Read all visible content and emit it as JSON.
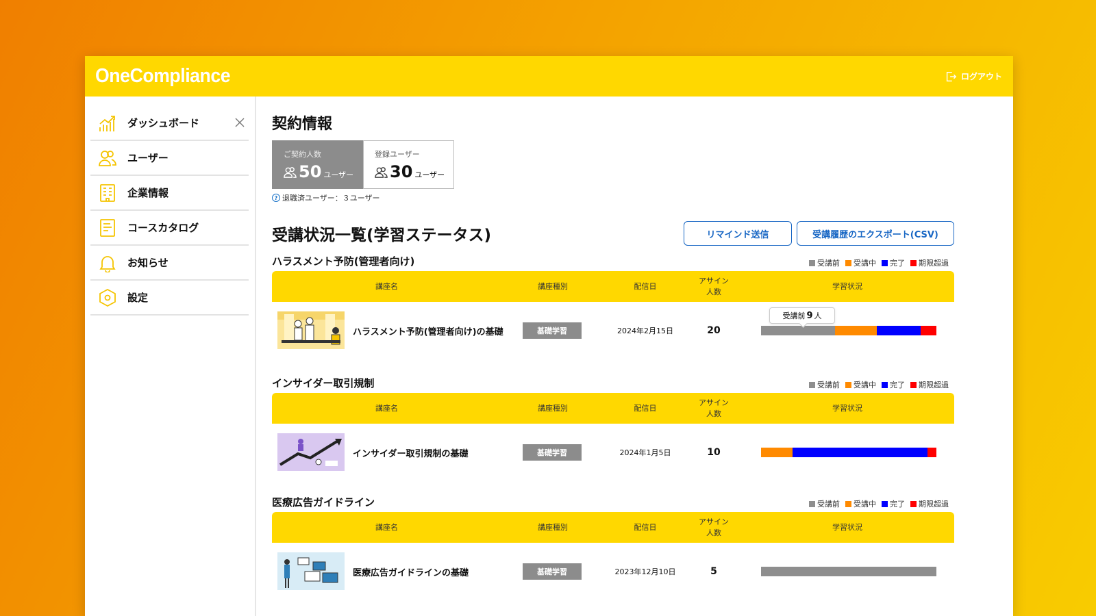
{
  "app": {
    "logo": "OneCompliance",
    "logout_label": "ログアウト"
  },
  "sidebar": {
    "items": [
      {
        "label": "ダッシュボード",
        "icon": "chart-icon"
      },
      {
        "label": "ユーザー",
        "icon": "users-icon"
      },
      {
        "label": "企業情報",
        "icon": "building-icon"
      },
      {
        "label": "コースカタログ",
        "icon": "document-icon"
      },
      {
        "label": "お知らせ",
        "icon": "bell-icon"
      },
      {
        "label": "設定",
        "icon": "settings-icon"
      }
    ]
  },
  "contract": {
    "title": "契約情報",
    "contracted": {
      "label": "ご契約人数",
      "value": "50",
      "unit": "ユーザー"
    },
    "registered": {
      "label": "登録ユーザー",
      "value": "30",
      "unit": "ユーザー"
    },
    "retired_note": "退職済ユーザー：３ユーザー"
  },
  "status": {
    "title": "受講状況一覧(学習ステータス)",
    "remind_button": "リマインド送信",
    "export_button": "受講履歴のエクスポート(CSV)"
  },
  "legend": [
    {
      "label": "受講前",
      "color": "#8e8e8e"
    },
    {
      "label": "受講中",
      "color": "#ff8a00"
    },
    {
      "label": "完了",
      "color": "#0000ff"
    },
    {
      "label": "期限超過",
      "color": "#ff0000"
    }
  ],
  "table_headers": {
    "name": "講座名",
    "type": "講座種別",
    "date": "配信日",
    "assign": "アサイン人数",
    "progress": "学習状況"
  },
  "courses": [
    {
      "section_title": "ハラスメント予防(管理者向け)",
      "name": "ハラスメント予防(管理者向け)の基礎",
      "type": "基礎学習",
      "date": "2024年2月15日",
      "assign": "20",
      "progress": {
        "before": 0.42,
        "in_progress": 0.24,
        "done": 0.25,
        "overdue": 0.09
      },
      "tooltip": {
        "label": "受講前",
        "value": "9",
        "unit": "人"
      }
    },
    {
      "section_title": "インサイダー取引規制",
      "name": "インサイダー取引規制の基礎",
      "type": "基礎学習",
      "date": "2024年1月5日",
      "assign": "10",
      "progress": {
        "before": 0,
        "in_progress": 0.18,
        "done": 0.77,
        "overdue": 0.05
      }
    },
    {
      "section_title": "医療広告ガイドライン",
      "name": "医療広告ガイドラインの基礎",
      "type": "基礎学習",
      "date": "2023年12月10日",
      "assign": "5",
      "progress": {
        "before": 1,
        "in_progress": 0,
        "done": 0,
        "overdue": 0
      }
    }
  ]
}
